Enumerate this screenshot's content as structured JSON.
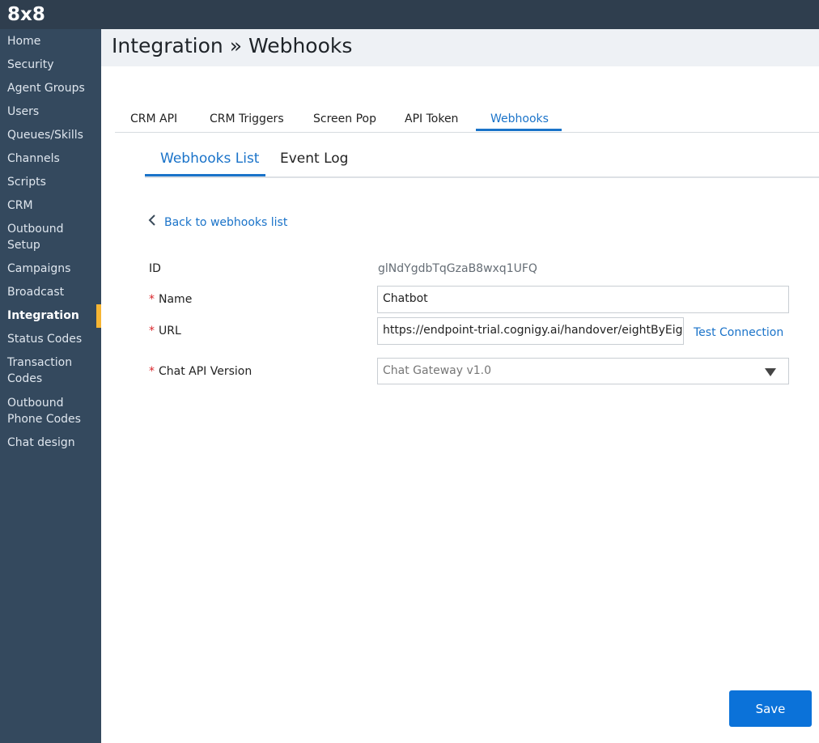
{
  "brand": {
    "logo": "8x8"
  },
  "sidebar": {
    "items": [
      {
        "label": "Home"
      },
      {
        "label": "Security"
      },
      {
        "label": "Agent Groups"
      },
      {
        "label": "Users"
      },
      {
        "label": "Queues/Skills"
      },
      {
        "label": "Channels"
      },
      {
        "label": "Scripts"
      },
      {
        "label": "CRM"
      },
      {
        "label": "Outbound\nSetup"
      },
      {
        "label": "Campaigns"
      },
      {
        "label": "Broadcast"
      },
      {
        "label": "Integration",
        "active": true
      },
      {
        "label": "Status Codes"
      },
      {
        "label": "Transaction\nCodes"
      },
      {
        "label": "Outbound\nPhone Codes"
      },
      {
        "label": "Chat design"
      }
    ]
  },
  "header": {
    "title": "Integration » Webhooks"
  },
  "tabs": [
    {
      "label": "CRM API"
    },
    {
      "label": "CRM Triggers"
    },
    {
      "label": "Screen Pop"
    },
    {
      "label": "API Token"
    },
    {
      "label": "Webhooks",
      "active": true
    }
  ],
  "subtabs": [
    {
      "label": "Webhooks List",
      "active": true
    },
    {
      "label": "Event Log"
    }
  ],
  "back_link": "Back to webhooks list",
  "form": {
    "id_label": "ID",
    "id_value": "glNdYgdbTqGzaB8wxq1UFQ",
    "required_mark": "*",
    "name_label": "Name",
    "name_value": "Chatbot",
    "url_label": "URL",
    "url_value": "https://endpoint-trial.cognigy.ai/handover/eightByEight",
    "test_connection": "Test Connection",
    "version_label": "Chat API Version",
    "version_value": "Chat Gateway v1.0"
  },
  "actions": {
    "save_label": "Save"
  },
  "colors": {
    "topbar": "#2f3e4e",
    "sidebar": "#34495e",
    "accent": "#1a73c9",
    "active_marker": "#f6b533",
    "required": "#d9262b",
    "save_button": "#0b72d9"
  }
}
